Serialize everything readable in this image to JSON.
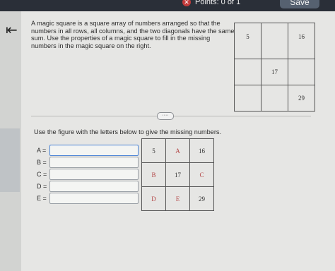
{
  "header": {
    "points_label": "Points: 0 of 1",
    "save_label": "Save",
    "x_icon": "close-icon"
  },
  "question": {
    "text": "A magic square is a square array of numbers arranged so that the numbers in all rows, all columns, and the two diagonals have the same sum. Use the properties of a magic square to fill in the missing numbers in the magic square on the right."
  },
  "magic_square": {
    "cells": [
      [
        "5",
        "",
        "16"
      ],
      [
        "",
        "17",
        ""
      ],
      [
        "",
        "",
        "29"
      ]
    ]
  },
  "divider": {
    "more_label": "····"
  },
  "instruction": "Use the figure with the letters below to give the missing numbers.",
  "answers": [
    {
      "label": "A =",
      "value": ""
    },
    {
      "label": "B =",
      "value": ""
    },
    {
      "label": "C =",
      "value": ""
    },
    {
      "label": "D =",
      "value": ""
    },
    {
      "label": "E =",
      "value": ""
    }
  ],
  "letter_square": {
    "cells": [
      [
        "5",
        "A",
        "16"
      ],
      [
        "B",
        "17",
        "C"
      ],
      [
        "D",
        "E",
        "29"
      ]
    ],
    "letter_color": "#b34646"
  }
}
